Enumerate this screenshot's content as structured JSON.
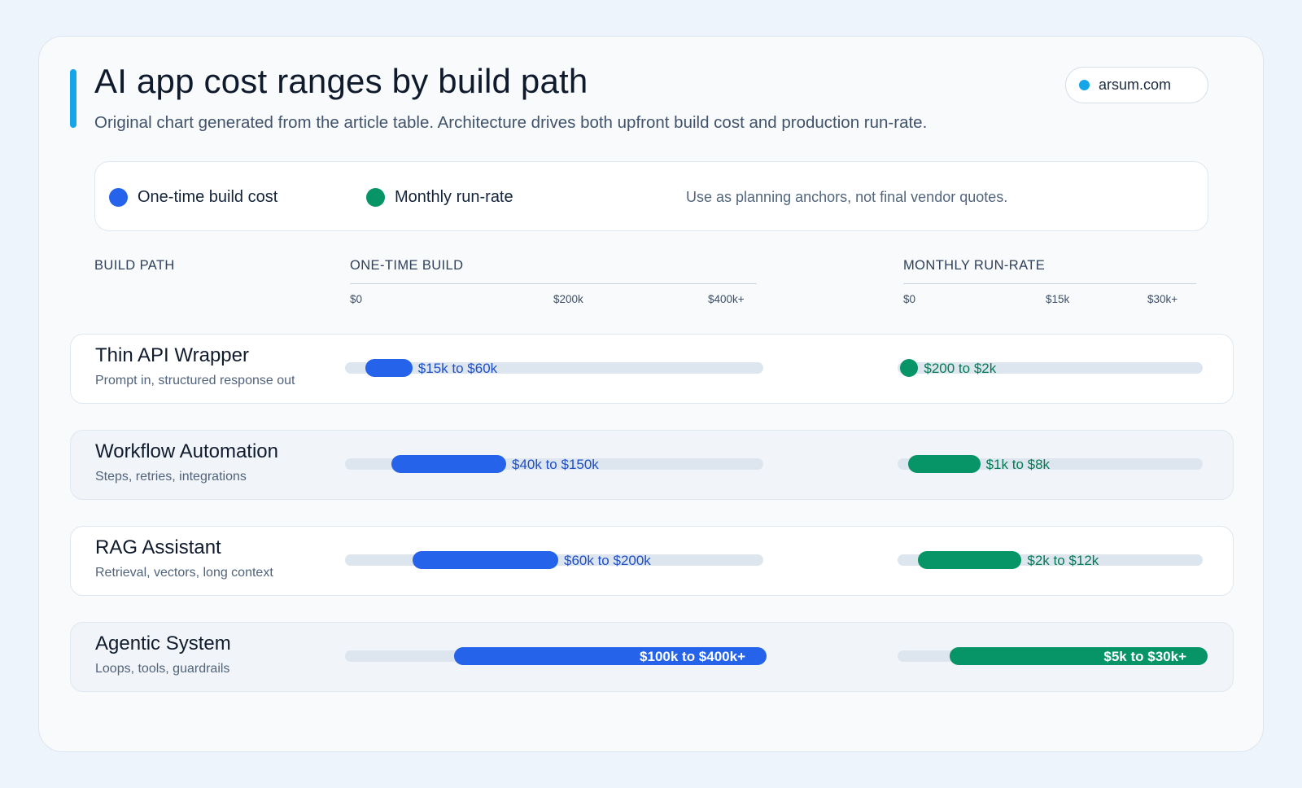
{
  "header": {
    "title": "AI app cost ranges by build path",
    "subtitle": "Original chart generated from the article table. Architecture drives both upfront build cost and production run-rate.",
    "brand": "arsum.com"
  },
  "legend": {
    "build_label": "One-time build cost",
    "run_label": "Monthly run-rate",
    "note": "Use as planning anchors, not final vendor quotes."
  },
  "colors": {
    "build": "#2563eb",
    "run": "#079467",
    "accent": "#14a6e6"
  },
  "columns": {
    "path": "BUILD PATH",
    "build": "ONE-TIME BUILD",
    "run": "MONTHLY RUN-RATE"
  },
  "chart_data": {
    "type": "bar",
    "layout": "horizontal range bars, two panels",
    "categories": [
      "Thin API Wrapper",
      "Workflow Automation",
      "RAG Assistant",
      "Agentic System"
    ],
    "descriptions": [
      "Prompt in, structured response out",
      "Steps, retries, integrations",
      "Retrieval, vectors, long context",
      "Loops, tools, guardrails"
    ],
    "build": {
      "axis_ticks": [
        "$0",
        "$200k",
        "$400k+"
      ],
      "xlim": [
        0,
        400000
      ],
      "ranges": [
        [
          15000,
          60000
        ],
        [
          40000,
          150000
        ],
        [
          60000,
          200000
        ],
        [
          100000,
          400000
        ]
      ],
      "labels": [
        "$15k to $60k",
        "$40k to $150k",
        "$60k to $200k",
        "$100k to $400k+"
      ]
    },
    "run": {
      "axis_ticks": [
        "$0",
        "$15k",
        "$30k+"
      ],
      "xlim": [
        0,
        30000
      ],
      "ranges": [
        [
          200,
          2000
        ],
        [
          1000,
          8000
        ],
        [
          2000,
          12000
        ],
        [
          5000,
          30000
        ]
      ],
      "labels": [
        "$200 to $2k",
        "$1k to $8k",
        "$2k to $12k",
        "$5k to $30k+"
      ]
    },
    "legend_position": "top"
  }
}
